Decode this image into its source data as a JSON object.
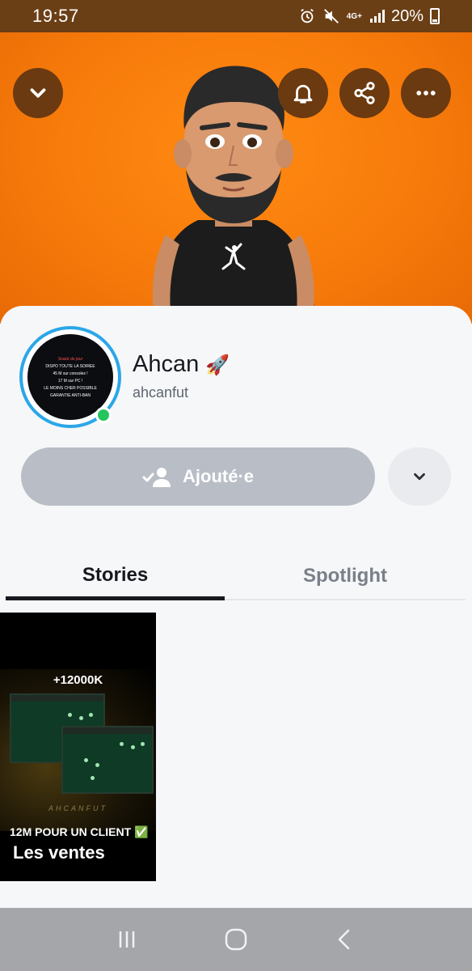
{
  "status_bar": {
    "time": "19:57",
    "network": "4G+",
    "battery": "20%"
  },
  "header": {
    "icons": [
      "chevron-down-icon",
      "bell-icon",
      "share-icon",
      "more-icon"
    ]
  },
  "profile": {
    "display_name": "Ahcan",
    "emoji": "🚀",
    "username": "ahcanfut",
    "avatar_text": {
      "line1": "Snack du jour",
      "line2": "DISPO TOUTE LA SOIREE",
      "line3": "45 M sur consoles !",
      "line4": "17 M sur PC !",
      "line5": "LE MOINS CHER POSSIBLE",
      "line6": "GARANTIE ANTI-BAN"
    }
  },
  "actions": {
    "added_label": "Ajouté·e"
  },
  "tabs": [
    {
      "label": "Stories",
      "active": true
    },
    {
      "label": "Spotlight",
      "active": false
    }
  ],
  "story": {
    "headline": "+12000K",
    "brand": "AHCANFUT",
    "client_text": "12M POUR UN CLIENT ✅",
    "title": "Les ventes"
  },
  "colors": {
    "hero": "#f77b0b",
    "ring": "#2aa7e8",
    "online": "#22c55e",
    "added_button": "#b9bec6"
  }
}
